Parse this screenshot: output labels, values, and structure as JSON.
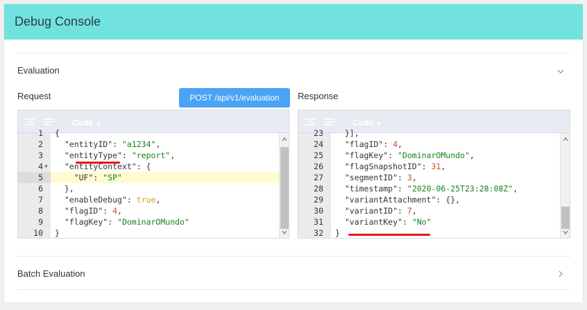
{
  "header": {
    "title": "Debug Console"
  },
  "evaluation": {
    "label": "Evaluation",
    "request_label": "Request",
    "response_label": "Response",
    "post_button": "POST /api/v1/evaluation",
    "request_editor": {
      "mode_label": "Code",
      "line_numbers": [
        "1",
        "2",
        "3",
        "4",
        "5",
        "6",
        "7",
        "8",
        "9",
        "10"
      ],
      "lines": [
        "{",
        "  \"entityID\": \"a1234\",",
        "  \"entityType\": \"report\",",
        "  \"entityContext\": {",
        "    \"UF\": \"SP\"",
        "  },",
        "  \"enableDebug\": true,",
        "  \"flagID\": 4,",
        "  \"flagKey\": \"DominarOMundo\"",
        "}"
      ]
    },
    "response_editor": {
      "mode_label": "Code",
      "line_numbers": [
        "23",
        "24",
        "25",
        "26",
        "27",
        "28",
        "29",
        "30",
        "31",
        "32"
      ],
      "lines": [
        "  }],",
        "  \"flagID\": 4,",
        "  \"flagKey\": \"DominarOMundo\",",
        "  \"flagSnapshotID\": 31,",
        "  \"segmentID\": 3,",
        "  \"timestamp\": \"2020-06-25T23:28:08Z\",",
        "  \"variantAttachment\": {},",
        "  \"variantID\": 7,",
        "  \"variantKey\": \"No\"",
        "}"
      ]
    }
  },
  "batch_evaluation": {
    "label": "Batch Evaluation"
  },
  "colors": {
    "header_bg": "#72e2de",
    "button_bg": "#4aa3f4",
    "highlight_underline": "#e3151e"
  }
}
